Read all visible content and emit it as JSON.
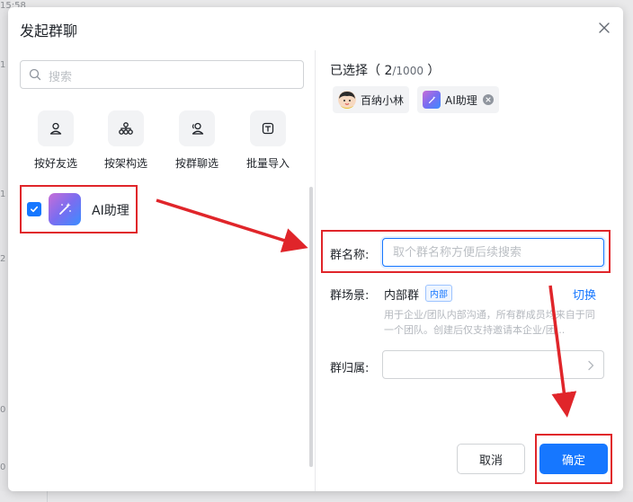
{
  "background": {
    "texts": [
      "15:58",
      "1",
      "1",
      "2",
      "0",
      "0"
    ]
  },
  "dialog": {
    "title": "发起群聊",
    "close_icon": "close-icon"
  },
  "search": {
    "placeholder": "搜索",
    "icon": "search-icon"
  },
  "select_options": [
    {
      "label": "按好友选",
      "icon": "user-icon"
    },
    {
      "label": "按架构选",
      "icon": "org-structure-icon"
    },
    {
      "label": "按群聊选",
      "icon": "group-chat-icon"
    },
    {
      "label": "批量导入",
      "icon": "import-icon"
    }
  ],
  "contacts": [
    {
      "name": "AI助理",
      "checked": true,
      "avatar": "ai-assistant-icon"
    }
  ],
  "selected": {
    "label": "已选择",
    "count": "2",
    "max": "/1000",
    "items": [
      {
        "name": "百纳小林",
        "avatar": "user-avatar"
      },
      {
        "name": "AI助理",
        "avatar": "ai-assistant-icon",
        "removable": true
      }
    ]
  },
  "form": {
    "name_label": "群名称:",
    "name_placeholder": "取个群名称方便后续搜索",
    "name_value": "",
    "scene_label": "群场景:",
    "scene_value": "内部群",
    "scene_badge": "内部",
    "switch_label": "切换",
    "scene_description": "用于企业/团队内部沟通，所有群成员均来自于同一个团队。创建后仅支持邀请本企业/团...",
    "owner_label": "群归属:",
    "owner_value": ""
  },
  "footer": {
    "cancel_label": "取消",
    "ok_label": "确定"
  },
  "colors": {
    "primary": "#1677ff",
    "annotation_red": "#e0252a",
    "text": "#1f2329",
    "placeholder": "#bbbfc4"
  }
}
